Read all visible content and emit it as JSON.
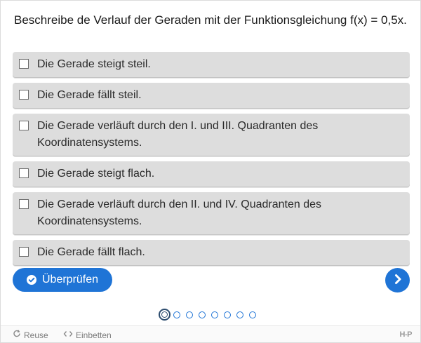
{
  "question": "Beschreibe de Verlauf der Geraden mit der Funktionsgleichung f(x) = 0,5x.",
  "options": [
    {
      "label": "Die Gerade steigt steil.",
      "checked": false
    },
    {
      "label": "Die Gerade fällt steil.",
      "checked": false
    },
    {
      "label": "Die Gerade verläuft durch den I. und III. Quadranten des Koordinatensystems.",
      "checked": false
    },
    {
      "label": "Die Gerade steigt flach.",
      "checked": false
    },
    {
      "label": "Die Gerade verläuft durch den II. und IV. Quadranten des Koordinatensystems.",
      "checked": false
    },
    {
      "label": "Die Gerade fällt flach.",
      "checked": false
    }
  ],
  "actions": {
    "check_label": "Überprüfen",
    "check_icon": "check-circle-icon",
    "next_icon": "chevron-right-icon"
  },
  "pagination": {
    "total": 8,
    "current": 1
  },
  "bottom_bar": {
    "reuse_label": "Reuse",
    "embed_label": "Einbetten",
    "logo_text": "H-P"
  },
  "colors": {
    "accent": "#1f74d6",
    "option_bg": "#dddddd",
    "current_dot": "#2c4c6e"
  }
}
